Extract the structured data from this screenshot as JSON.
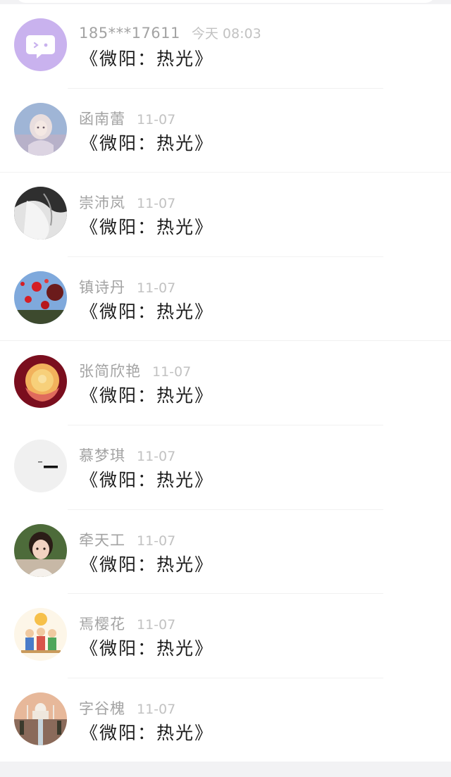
{
  "notifications": [
    {
      "name": "185***17611",
      "date": "今天 08:03",
      "title": "《微阳：热光》",
      "avatar": "chat-bubble-avatar"
    },
    {
      "name": "函南蕾",
      "date": "11-07",
      "title": "《微阳：热光》",
      "avatar": "girl-doll-avatar"
    },
    {
      "name": "崇沛岚",
      "date": "11-07",
      "title": "《微阳：热光》",
      "avatar": "fabric-avatar"
    },
    {
      "name": "镇诗丹",
      "date": "11-07",
      "title": "《微阳：热光》",
      "avatar": "red-balloons-avatar"
    },
    {
      "name": "张简欣艳",
      "date": "11-07",
      "title": "《微阳：热光》",
      "avatar": "rose-avatar"
    },
    {
      "name": "慕梦琪",
      "date": "11-07",
      "title": "《微阳：热光》",
      "avatar": "minimal-dash-avatar"
    },
    {
      "name": "牵天工",
      "date": "11-07",
      "title": "《微阳：热光》",
      "avatar": "child-photo-avatar"
    },
    {
      "name": "焉樱花",
      "date": "11-07",
      "title": "《微阳：热光》",
      "avatar": "cartoon-family-avatar"
    },
    {
      "name": "字谷槐",
      "date": "11-07",
      "title": "《微阳：热光》",
      "avatar": "taj-mahal-avatar"
    }
  ]
}
